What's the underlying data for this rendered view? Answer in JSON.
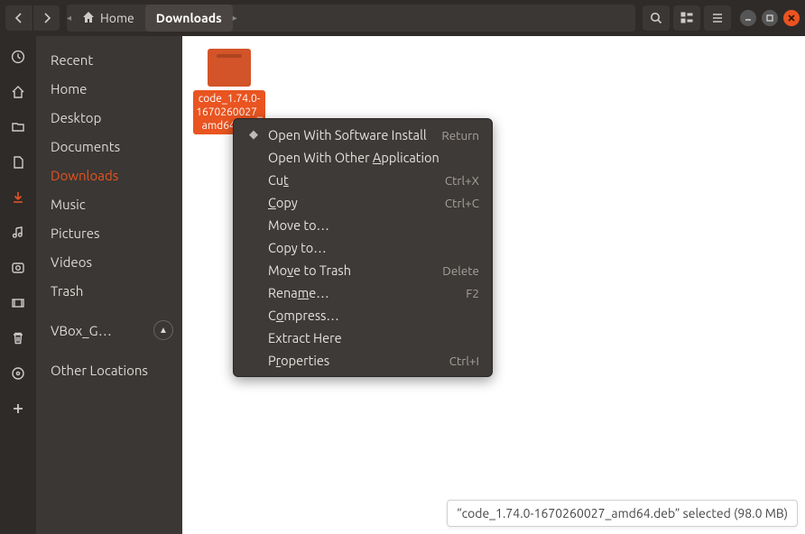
{
  "path": {
    "home": "Home",
    "current": "Downloads"
  },
  "sidebar": {
    "items": [
      "Recent",
      "Home",
      "Desktop",
      "Documents",
      "Downloads",
      "Music",
      "Pictures",
      "Videos",
      "Trash",
      "VBox_G…",
      "Other Locations"
    ]
  },
  "file": {
    "label": "code_1.74.0-1670260027_amd64.deb",
    "label_wrapped": "code_\n1.74.0-\n1670260027_amd64.deb"
  },
  "ctx": {
    "open_with_install": "Open With Software Install",
    "open_with_other": "Open With Other Application",
    "cut": "Cut",
    "copy": "Copy",
    "move_to": "Move to…",
    "copy_to": "Copy to…",
    "move_trash": "Move to Trash",
    "rename": "Rename…",
    "compress": "Compress…",
    "extract": "Extract Here",
    "properties": "Properties",
    "accel": {
      "return": "Return",
      "cut": "Ctrl+X",
      "copy": "Ctrl+C",
      "trash": "Delete",
      "rename": "F2",
      "props": "Ctrl+I"
    }
  },
  "status": "“code_1.74.0-1670260027_amd64.deb” selected  (98.0 MB)"
}
